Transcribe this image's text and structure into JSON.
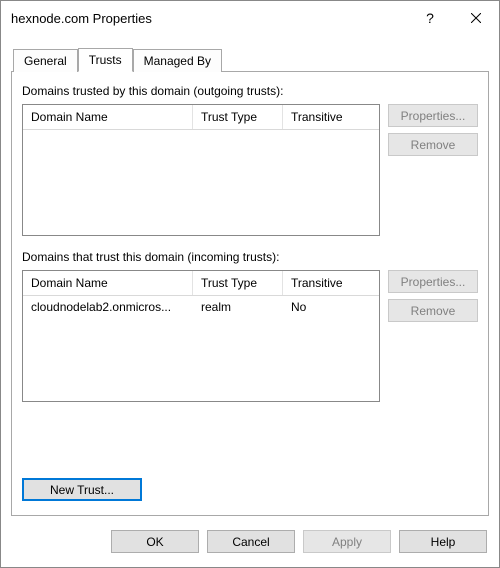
{
  "window": {
    "title": "hexnode.com Properties"
  },
  "tabs": {
    "general": "General",
    "trusts": "Trusts",
    "managedBy": "Managed By"
  },
  "outgoing": {
    "label": "Domains trusted by this domain (outgoing trusts):",
    "columns": {
      "domain": "Domain Name",
      "type": "Trust Type",
      "transitive": "Transitive"
    },
    "rows": []
  },
  "incoming": {
    "label": "Domains that trust this domain (incoming trusts):",
    "columns": {
      "domain": "Domain Name",
      "type": "Trust Type",
      "transitive": "Transitive"
    },
    "rows": [
      {
        "domain": "cloudnodelab2.onmicros...",
        "type": "realm",
        "transitive": "No"
      }
    ]
  },
  "buttons": {
    "properties": "Properties...",
    "remove": "Remove",
    "newTrust": "New Trust...",
    "ok": "OK",
    "cancel": "Cancel",
    "apply": "Apply",
    "help": "Help"
  }
}
